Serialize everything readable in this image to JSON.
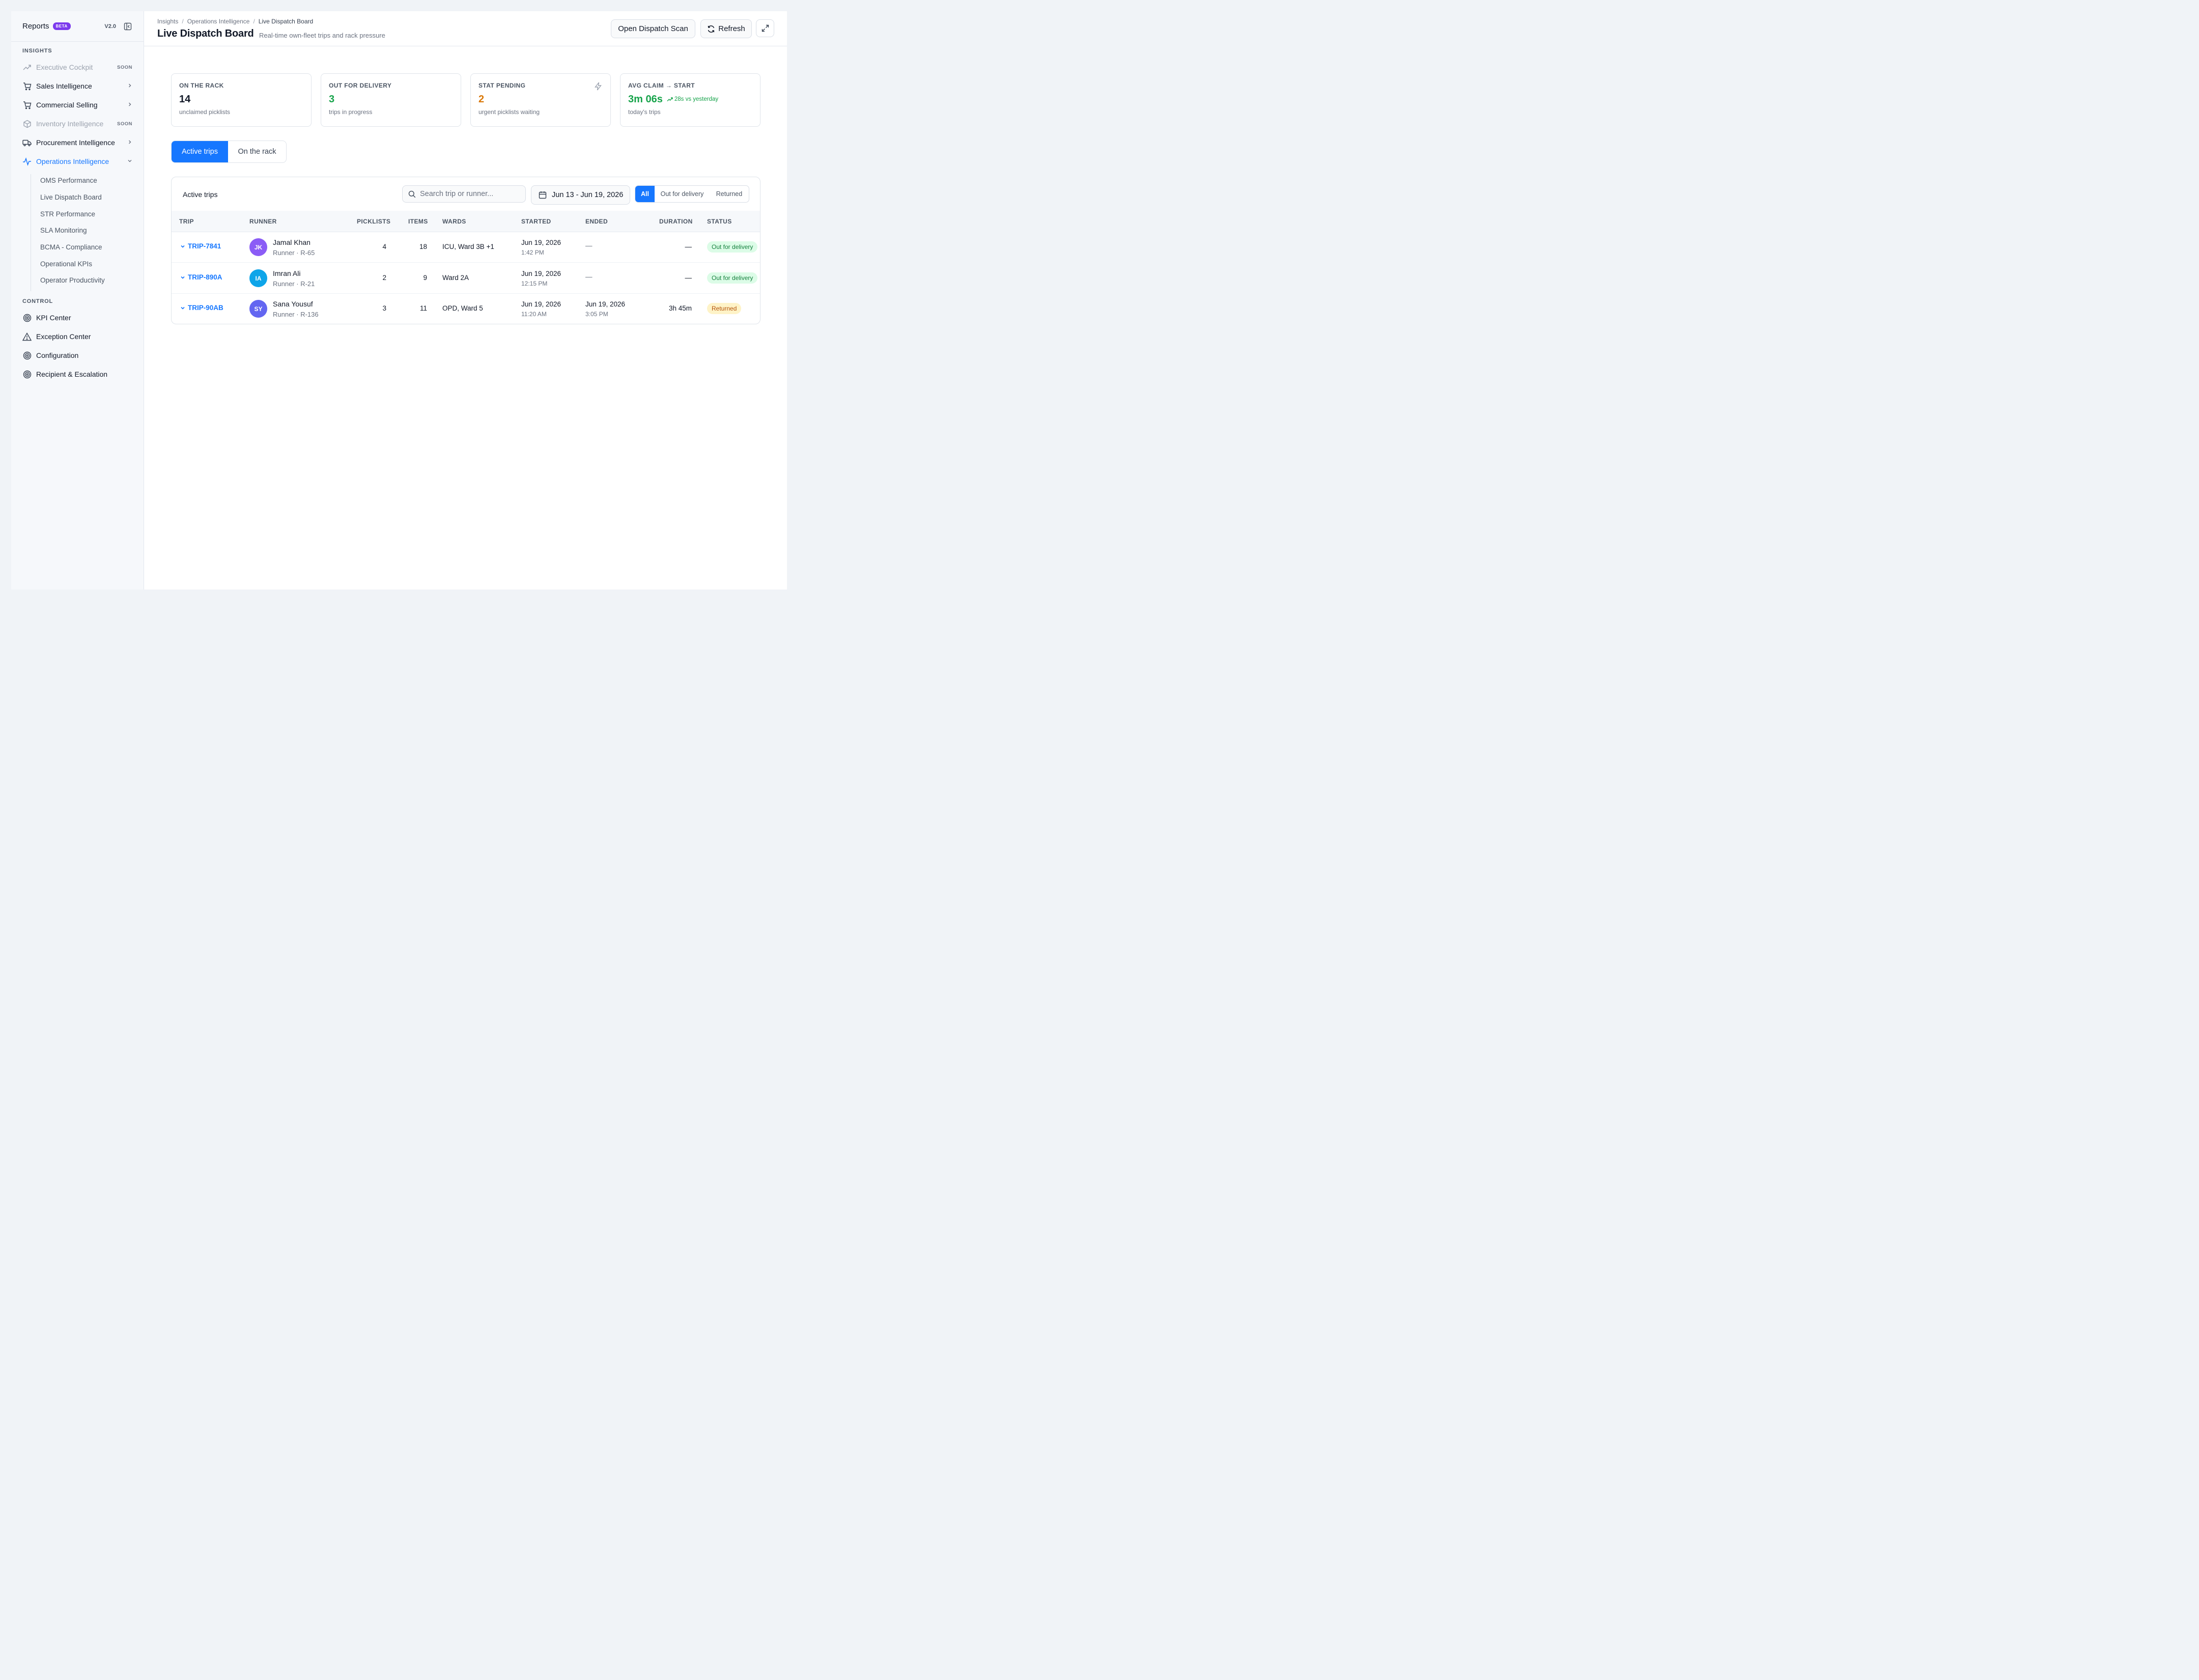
{
  "sidebar": {
    "brand": "Reports",
    "beta": "BETA",
    "version": "V2.0",
    "sections": {
      "insights": "INSIGHTS",
      "control": "CONTROL"
    },
    "insights_items": [
      {
        "label": "Executive Cockpit",
        "tag": "SOON",
        "icon": "trend-up-icon"
      },
      {
        "label": "Sales Intelligence",
        "icon": "cart-icon"
      },
      {
        "label": "Commercial Selling",
        "icon": "cart-icon"
      },
      {
        "label": "Inventory Intelligence",
        "tag": "SOON",
        "icon": "box-icon"
      },
      {
        "label": "Procurement Intelligence",
        "icon": "truck-icon"
      },
      {
        "label": "Operations Intelligence",
        "icon": "activity-icon"
      }
    ],
    "operations_sub": [
      "OMS Performance",
      "Live Dispatch Board",
      "STR Performance",
      "SLA Monitoring",
      "BCMA - Compliance",
      "Operational KPIs",
      "Operator Productivity"
    ],
    "control_items": [
      {
        "label": "KPI Center",
        "icon": "target-icon"
      },
      {
        "label": "Exception Center",
        "icon": "warning-icon"
      },
      {
        "label": "Configuration",
        "icon": "target-icon"
      },
      {
        "label": "Recipient & Escalation",
        "icon": "target-icon"
      }
    ]
  },
  "header": {
    "breadcrumb": [
      "Insights",
      "Operations Intelligence",
      "Live Dispatch Board"
    ],
    "separator": "/",
    "title": "Live Dispatch Board",
    "subtitle": "Real-time own-fleet trips and rack pressure",
    "scan_button": "Open Dispatch Scan",
    "refresh_button": "Refresh"
  },
  "kpis": [
    {
      "label": "ON THE RACK",
      "value": "14",
      "desc": "unclaimed picklists",
      "color": "#111827"
    },
    {
      "label": "OUT FOR DELIVERY",
      "value": "3",
      "desc": "trips in progress",
      "color": "#16a34a"
    },
    {
      "label": "STAT PENDING",
      "value": "2",
      "desc": "urgent picklists waiting",
      "color": "#d97706"
    },
    {
      "label": "AVG CLAIM → START",
      "value": "3m 06s",
      "trend": "28s vs yesterday",
      "desc": "today's trips",
      "color": "#16a34a"
    }
  ],
  "tabs": {
    "active": "Active trips",
    "rack": "On the rack"
  },
  "table": {
    "title": "Active trips",
    "search_placeholder": "Search trip or runner...",
    "date_range": "Jun 13 - Jun 19, 2026",
    "filters": [
      "All",
      "Out for delivery",
      "Returned"
    ],
    "columns": [
      "TRIP",
      "RUNNER",
      "PICKLISTS",
      "ITEMS",
      "WARDS",
      "STARTED",
      "ENDED",
      "DURATION",
      "STATUS"
    ],
    "rows": [
      {
        "trip": "TRIP-7841",
        "initials": "JK",
        "avatar": "#8b5cf6",
        "runner": "Jamal Khan",
        "runner_id": "Runner · R-65",
        "picklists": "4",
        "items": "18",
        "wards": "ICU, Ward 3B +1",
        "started_date": "Jun 19, 2026",
        "started_time": "1:42 PM",
        "ended_date": "—",
        "ended_time": "",
        "duration": "—",
        "status": "Out for delivery"
      },
      {
        "trip": "TRIP-890A",
        "initials": "IA",
        "avatar": "#0ea5e9",
        "runner": "Imran Ali",
        "runner_id": "Runner · R-21",
        "picklists": "2",
        "items": "9",
        "wards": "Ward 2A",
        "started_date": "Jun 19, 2026",
        "started_time": "12:15 PM",
        "ended_date": "—",
        "ended_time": "",
        "duration": "—",
        "status": "Out for delivery"
      },
      {
        "trip": "TRIP-90AB",
        "initials": "SY",
        "avatar": "#6366f1",
        "runner": "Sana Yousuf",
        "runner_id": "Runner · R-136",
        "picklists": "3",
        "items": "11",
        "wards": "OPD, Ward 5",
        "started_date": "Jun 19, 2026",
        "started_time": "11:20 AM",
        "ended_date": "Jun 19, 2026",
        "ended_time": "3:05 PM",
        "duration": "3h 45m",
        "status": "Returned"
      }
    ]
  },
  "colors": {
    "accent": "#1677ff",
    "out_bg": "#dcfce7",
    "out_fg": "#15803d",
    "ret_bg": "#fef3c7",
    "ret_fg": "#b45309"
  }
}
